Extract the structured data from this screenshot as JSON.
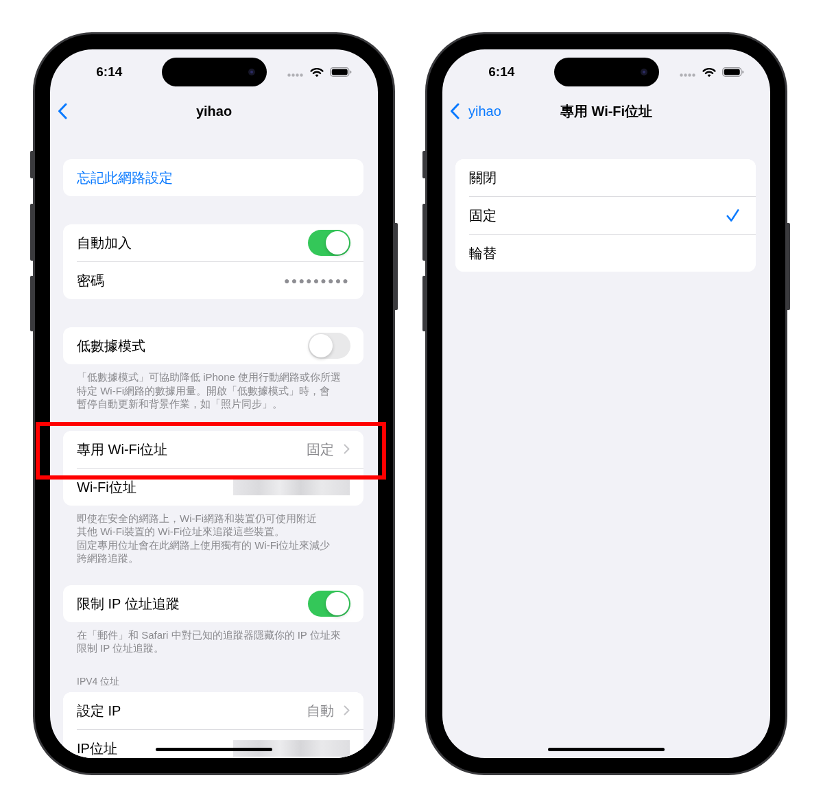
{
  "screens": [
    {
      "status_bar": {
        "time": "6:14"
      },
      "nav_bar": {
        "title": "yihao"
      },
      "sections": [
        {
          "rows": [
            {
              "kind": "action",
              "label": "忘記此網路設定",
              "highlighted": false
            }
          ]
        },
        {
          "rows": [
            {
              "kind": "toggle",
              "label": "自動加入",
              "on": true,
              "highlighted": false
            },
            {
              "kind": "secret",
              "label": "密碼",
              "value": "●●●●●●●●●",
              "highlighted": false
            }
          ]
        },
        {
          "rows": [
            {
              "kind": "toggle",
              "label": "低數據模式",
              "on": false,
              "highlighted": false
            }
          ],
          "footer_lines": [
            "「低數據模式」可協助降低 iPhone 使用行動網路或你所選",
            "特定 Wi-Fi網路的數據用量。開啟「低數據模式」時，會",
            "暫停自動更新和背景作業，如「照片同步」。"
          ]
        },
        {
          "rows": [
            {
              "kind": "disclosure",
              "label": "專用 Wi-Fi位址",
              "value": "固定",
              "highlighted": true
            },
            {
              "kind": "redacted",
              "label": "Wi-Fi位址",
              "highlighted": false
            }
          ],
          "footer_lines": [
            "即使在安全的網路上，Wi-Fi網路和裝置仍可使用附近",
            "其他 Wi-Fi裝置的 Wi-Fi位址來追蹤這些裝置。",
            "固定專用位址會在此網路上使用獨有的 Wi-Fi位址來減少",
            "跨網路追蹤。"
          ]
        },
        {
          "rows": [
            {
              "kind": "toggle",
              "label": "限制 IP 位址追蹤",
              "on": true,
              "highlighted": false
            }
          ],
          "footer_lines": [
            "在「郵件」和 Safari 中對已知的追蹤器隱藏你的 IP 位址來",
            "限制 IP 位址追蹤。"
          ]
        },
        {
          "header": "IPV4 位址",
          "rows": [
            {
              "kind": "disclosure",
              "label": "設定 IP",
              "value": "自動",
              "highlighted": false
            },
            {
              "kind": "redacted",
              "label": "IP位址",
              "highlighted": false
            }
          ]
        }
      ]
    },
    {
      "status_bar": {
        "time": "6:14"
      },
      "nav_bar": {
        "back_label": "yihao",
        "title": "專用 Wi-Fi位址"
      },
      "sections": [
        {
          "rows": [
            {
              "kind": "option",
              "label": "關閉",
              "selected": false
            },
            {
              "kind": "option",
              "label": "固定",
              "selected": true
            },
            {
              "kind": "option",
              "label": "輪替",
              "selected": false
            }
          ]
        }
      ]
    }
  ]
}
